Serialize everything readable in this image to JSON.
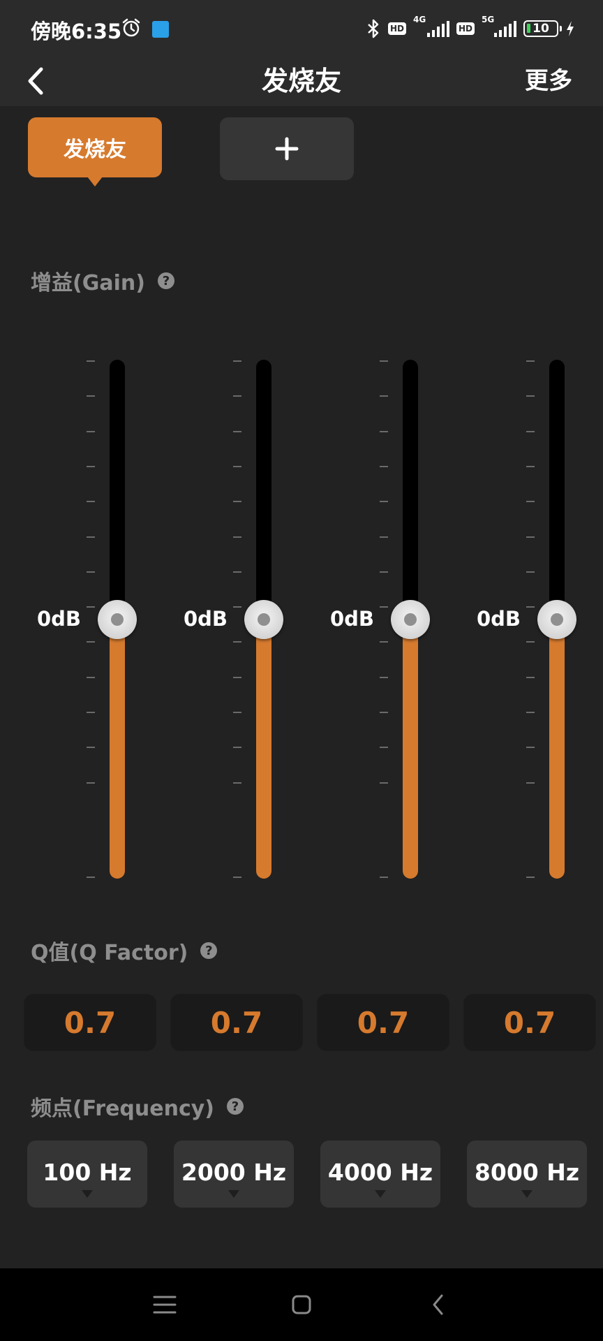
{
  "status_bar": {
    "time": "傍晚6:35",
    "network_1": "4G",
    "network_2": "5G",
    "hd_1": "HD",
    "hd_2": "HD",
    "battery": "10",
    "icons": [
      "alarm-icon",
      "app-notification-icon",
      "bluetooth-icon",
      "signal-icon",
      "battery-icon",
      "charging-icon"
    ]
  },
  "header": {
    "back_icon": "chevron-left-icon",
    "title": "发烧友",
    "more_label": "更多"
  },
  "presets": {
    "active_label": "发烧友",
    "add_icon": "plus-icon"
  },
  "gain": {
    "label": "增益(Gain)",
    "help_icon": "question-circle-icon",
    "bands": [
      {
        "value_label": "0dB",
        "level": 0.5
      },
      {
        "value_label": "0dB",
        "level": 0.5
      },
      {
        "value_label": "0dB",
        "level": 0.5
      },
      {
        "value_label": "0dB",
        "level": 0.5
      }
    ]
  },
  "q_factor": {
    "label": "Q值(Q Factor)",
    "help_icon": "question-circle-icon",
    "values": [
      "0.7",
      "0.7",
      "0.7",
      "0.7"
    ]
  },
  "frequency": {
    "label": "频点(Frequency)",
    "help_icon": "question-circle-icon",
    "values": [
      "100 Hz",
      "2000 Hz",
      "4000 Hz",
      "8000 Hz"
    ]
  },
  "nav_bar": {
    "icons": [
      "menu-icon",
      "home-square-icon",
      "back-triangle-icon"
    ]
  },
  "colors": {
    "accent": "#d67a2e",
    "background": "#222222",
    "header": "#2b2b2b",
    "muted_text": "#8e8e8e"
  }
}
